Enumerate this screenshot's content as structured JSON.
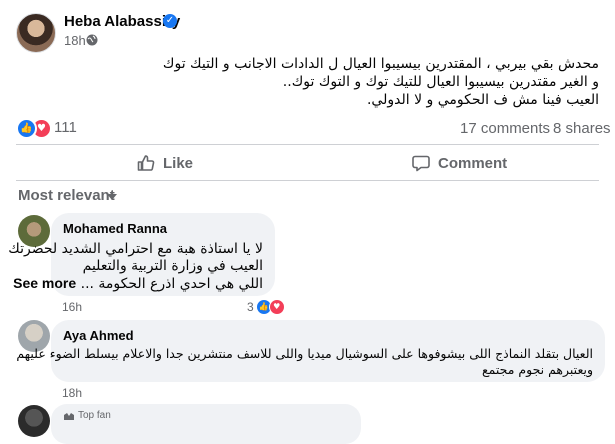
{
  "post": {
    "author": "Heba Alabassiry",
    "time": "18h",
    "lines": [
      "محدش بقي بيربي ، المقتدرين بيسيبوا العيال ل الدادات الاجانب و التيك توك",
      "و الغير مقتدرين بيسيبوا العيال للتيك توك و التوك توك..",
      "العيب فينا مش ف الحكومي و لا الدولي."
    ],
    "reactions_count": "111",
    "comments_count": "17 comments",
    "shares_count": "8 shares"
  },
  "actions": {
    "like": "Like",
    "comment": "Comment"
  },
  "filter": {
    "label": "Most relevant"
  },
  "comments": [
    {
      "name": "Mohamed Ranna",
      "lines": [
        "لا يا استاذة هبة مع احترامي الشديد لحضرتك",
        "العيب في وزارة التربية والتعليم",
        "اللي هي احدي اذرع الحكومة ..."
      ],
      "see_more": "See more",
      "time": "16h",
      "reactions": "3"
    },
    {
      "name": "Aya Ahmed",
      "lines": [
        "العيال بتقلد النماذج اللى بيشوفوها على السوشيال ميديا واللى للاسف منتشرين جدا والاعلام بيسلط الضوء عليهم",
        "ويعتبرهم نجوم مجتمع"
      ],
      "time": "18h"
    },
    {
      "badge": "Top fan"
    }
  ],
  "colors": {
    "accent": "#1877f2",
    "love": "#f33e58",
    "muted": "#65676b",
    "bubble": "#f0f2f5"
  }
}
